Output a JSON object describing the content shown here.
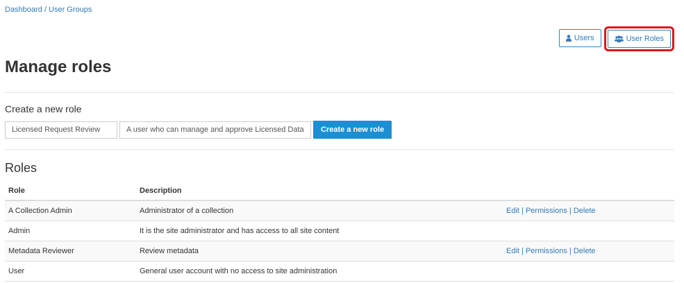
{
  "breadcrumb": {
    "items": [
      "Dashboard",
      "User Groups"
    ],
    "separator": "/"
  },
  "top_buttons": {
    "users_label": "Users",
    "user_roles_label": "User Roles",
    "users_icon": "user-icon",
    "user_roles_icon": "users-group-icon",
    "highlight_color": "#e0161b"
  },
  "page": {
    "title": "Manage roles"
  },
  "create_form": {
    "label": "Create a new role",
    "name_value": "Licensed Request Review",
    "description_value": "A user who can manage and approve Licensed Data",
    "submit_label": "Create a new role"
  },
  "roles": {
    "title": "Roles",
    "columns": [
      "Role",
      "Description"
    ],
    "rows": [
      {
        "role": "A Collection Admin",
        "description": "Administrator of a collection",
        "actions": [
          "Edit",
          "Permissions",
          "Delete"
        ]
      },
      {
        "role": "Admin",
        "description": "It is the site administrator and has access to all site content",
        "actions": []
      },
      {
        "role": "Metadata Reviewer",
        "description": "Review metadata",
        "actions": [
          "Edit",
          "Permissions",
          "Delete"
        ]
      },
      {
        "role": "User",
        "description": "General user account with no access to site administration",
        "actions": []
      }
    ]
  },
  "colors": {
    "link": "#337ab7",
    "primary": "#1b8fd2"
  }
}
